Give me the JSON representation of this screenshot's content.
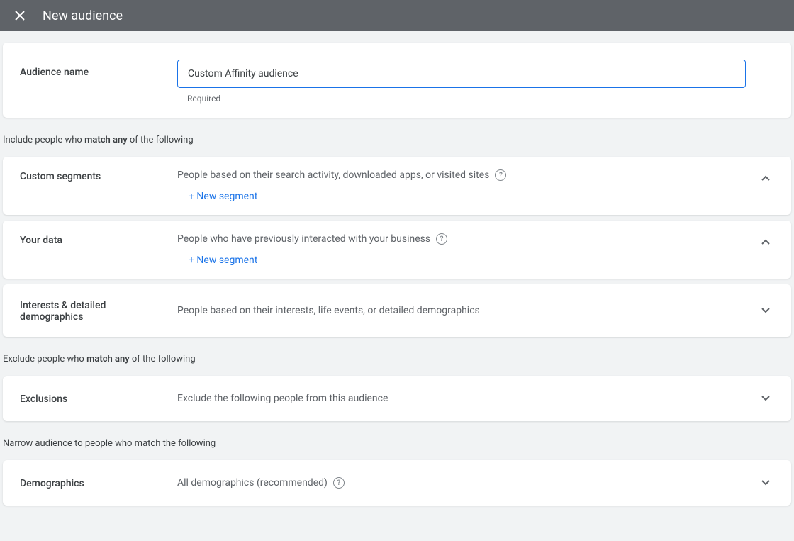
{
  "header": {
    "title": "New audience"
  },
  "audienceName": {
    "label": "Audience name",
    "value": "Custom Affinity audience",
    "requiredText": "Required"
  },
  "includeLabel": {
    "prefix": "Include people who ",
    "bold": "match any",
    "suffix": " of the following"
  },
  "excludeLabel": {
    "prefix": "Exclude people who ",
    "bold": "match any",
    "suffix": " of the following"
  },
  "narrowLabel": {
    "text": "Narrow audience to people who match the following"
  },
  "segments": {
    "custom": {
      "title": "Custom segments",
      "desc": "People based on their search activity, downloaded apps, or visited sites",
      "newSegment": "+ New segment"
    },
    "yourData": {
      "title": "Your data",
      "desc": "People who have previously interacted with your business",
      "newSegment": "+ New segment"
    },
    "interests": {
      "title": "Interests & detailed demographics",
      "desc": "People based on their interests, life events, or detailed demographics"
    },
    "exclusions": {
      "title": "Exclusions",
      "desc": "Exclude the following people from this audience"
    },
    "demographics": {
      "title": "Demographics",
      "desc": "All demographics (recommended)"
    }
  }
}
